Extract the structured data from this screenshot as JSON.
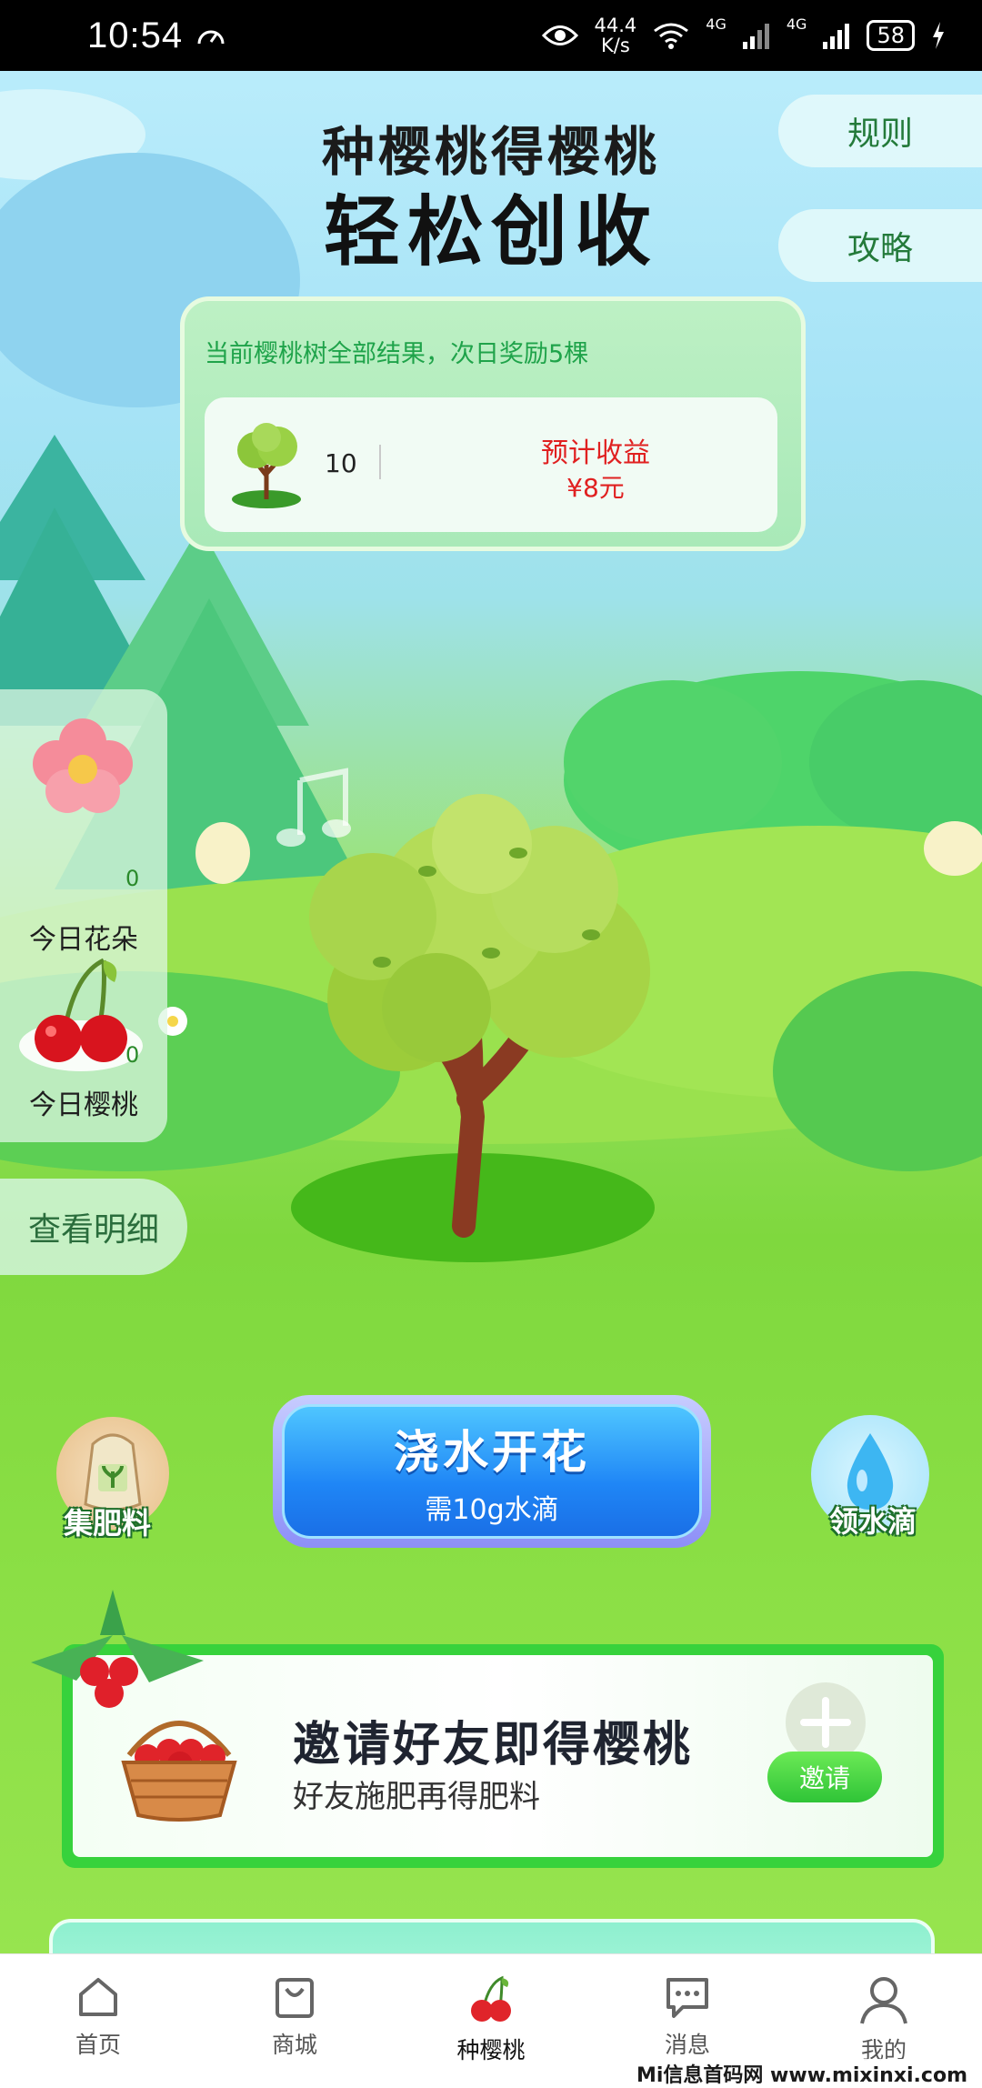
{
  "status_bar": {
    "time": "10:54",
    "net_speed_value": "44.4",
    "net_speed_unit": "K/s",
    "signal1_label": "4G",
    "signal2_label": "4G",
    "battery": "58"
  },
  "header": {
    "title_line1": "种樱桃得樱桃",
    "title_line2": "轻松创收",
    "rules_label": "规则",
    "guide_label": "攻略"
  },
  "info_card": {
    "note": "当前樱桃树全部结果，次日奖励5棵",
    "tree_count": "10",
    "income_label": "预计收益",
    "income_value": "¥8元"
  },
  "stats": {
    "flowers_label": "今日花朵",
    "flowers_count": "0",
    "cherries_label": "今日樱桃",
    "cherries_count": "0"
  },
  "detail_button": "查看明细",
  "actions": {
    "fertilizer_label": "集肥料",
    "water_main": "浇水开花",
    "water_sub": "需10g水滴",
    "droplet_label": "领水滴"
  },
  "invite": {
    "title": "邀请好友即得樱桃",
    "subtitle": "好友施肥再得肥料",
    "button": "邀请"
  },
  "tabs": [
    {
      "label": "首页",
      "icon": "home-icon"
    },
    {
      "label": "商城",
      "icon": "shopping-bag-icon"
    },
    {
      "label": "种樱桃",
      "icon": "cherry-icon"
    },
    {
      "label": "消息",
      "icon": "message-icon"
    },
    {
      "label": "我的",
      "icon": "profile-icon"
    }
  ],
  "active_tab_index": 2,
  "watermark": "Mi信息首码网 www.mixinxi.com",
  "colors": {
    "accent_green": "#37d23c",
    "income_red": "#e02020",
    "water_blue": "#1f86f6"
  }
}
